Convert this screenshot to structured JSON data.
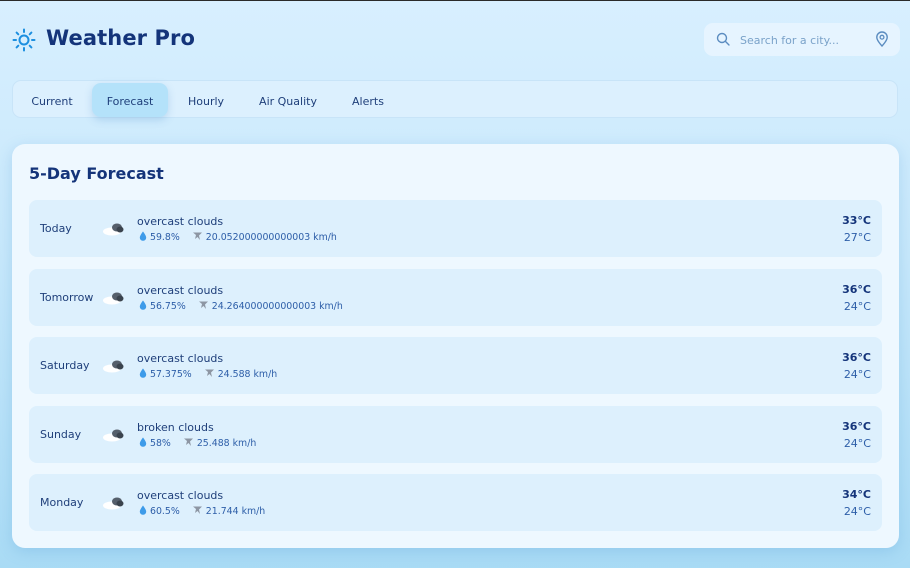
{
  "app": {
    "title": "Weather Pro"
  },
  "search": {
    "placeholder": "Search for a city...",
    "value": ""
  },
  "tabs": [
    {
      "label": "Current",
      "active": false
    },
    {
      "label": "Forecast",
      "active": true
    },
    {
      "label": "Hourly",
      "active": false
    },
    {
      "label": "Air Quality",
      "active": false
    },
    {
      "label": "Alerts",
      "active": false
    }
  ],
  "forecast": {
    "title": "5-Day Forecast",
    "days": [
      {
        "day": "Today",
        "icon": "cloud-icon",
        "description": "overcast clouds",
        "humidity": "59.8%",
        "wind": "20.052000000000003 km/h",
        "high": "33°C",
        "low": "27°C"
      },
      {
        "day": "Tomorrow",
        "icon": "cloud-icon",
        "description": "overcast clouds",
        "humidity": "56.75%",
        "wind": "24.264000000000003 km/h",
        "high": "36°C",
        "low": "24°C"
      },
      {
        "day": "Saturday",
        "icon": "cloud-icon",
        "description": "overcast clouds",
        "humidity": "57.375%",
        "wind": "24.588 km/h",
        "high": "36°C",
        "low": "24°C"
      },
      {
        "day": "Sunday",
        "icon": "cloud-icon",
        "description": "broken clouds",
        "humidity": "58%",
        "wind": "25.488 km/h",
        "high": "36°C",
        "low": "24°C"
      },
      {
        "day": "Monday",
        "icon": "cloud-icon",
        "description": "overcast clouds",
        "humidity": "60.5%",
        "wind": "21.744 km/h",
        "high": "34°C",
        "low": "24°C"
      }
    ]
  },
  "colors": {
    "accent": "#14347a",
    "active_tab": "#b4e2fa",
    "sun_icon": "#1c8fe0"
  }
}
